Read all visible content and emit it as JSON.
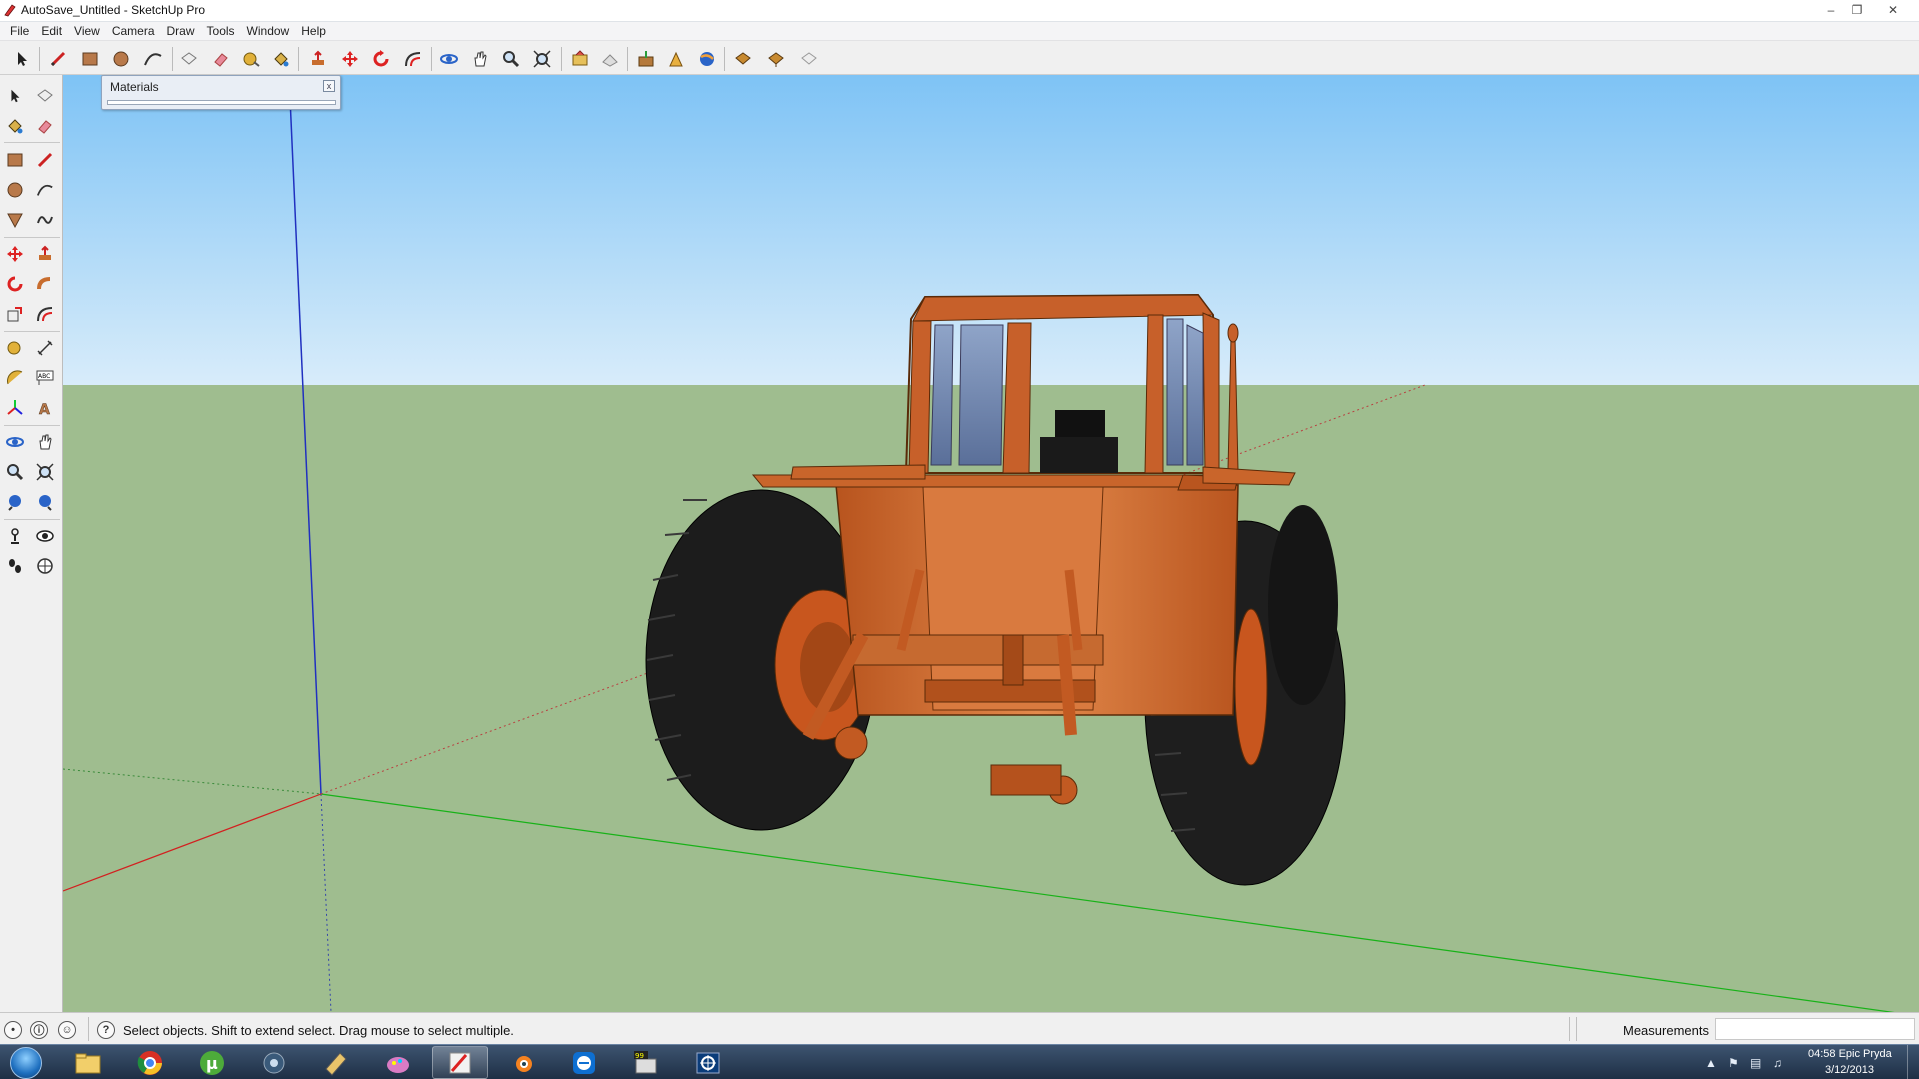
{
  "window": {
    "title": "AutoSave_Untitled - SketchUp Pro",
    "minimize_icon": "minimize-icon",
    "maximize_icon": "restore-icon",
    "close_icon": "close-icon"
  },
  "menubar": {
    "items": [
      "File",
      "Edit",
      "View",
      "Camera",
      "Draw",
      "Tools",
      "Window",
      "Help"
    ]
  },
  "toolbar": {
    "tools": [
      "select",
      "line",
      "rectangle",
      "circle",
      "arc",
      "make-component",
      "eraser",
      "tape-measure",
      "paint-bucket",
      "push-pull",
      "move",
      "rotate",
      "offset",
      "orbit",
      "pan",
      "zoom",
      "zoom-extents",
      "get-models",
      "share-model",
      "add-location",
      "toggle-terrain",
      "preview-google-earth",
      "get-photo-texture",
      "share-component",
      "3d-warehouse"
    ]
  },
  "left_toolbar": {
    "tools": [
      "select",
      "make-component",
      "paint-bucket",
      "eraser",
      "rectangle",
      "line",
      "circle",
      "arc",
      "polygon",
      "freehand",
      "move",
      "push-pull",
      "rotate",
      "follow-me",
      "scale",
      "offset",
      "tape-measure",
      "dimension",
      "protractor",
      "text",
      "axes",
      "3d-text",
      "orbit",
      "pan",
      "zoom",
      "zoom-window",
      "previous",
      "next",
      "position-camera",
      "look-around",
      "walk",
      "section-plane"
    ]
  },
  "materials_panel": {
    "title": "Materials",
    "close_label": "x"
  },
  "viewport": {
    "sky_color": "#8ccaf5",
    "ground_color": "#9fbd8f",
    "model": "tractor"
  },
  "statusbar": {
    "icon_1": "geo-location-icon",
    "icon_2": "credits-icon",
    "icon_3": "user-icon",
    "help_icon": "?",
    "message": "Select objects. Shift to extend select. Drag mouse to select multiple.",
    "measurements_label": "Measurements",
    "measurements_value": ""
  },
  "taskbar": {
    "apps": [
      "file-explorer",
      "chrome",
      "utorrent",
      "steam",
      "sketchup-tray",
      "paint-app",
      "sketchup",
      "blender",
      "teamviewer",
      "notepad-99",
      "network-app"
    ],
    "active_app": "sketchup",
    "clock_time": "04:58 Epic Pryda",
    "clock_date": "3/12/2013"
  }
}
